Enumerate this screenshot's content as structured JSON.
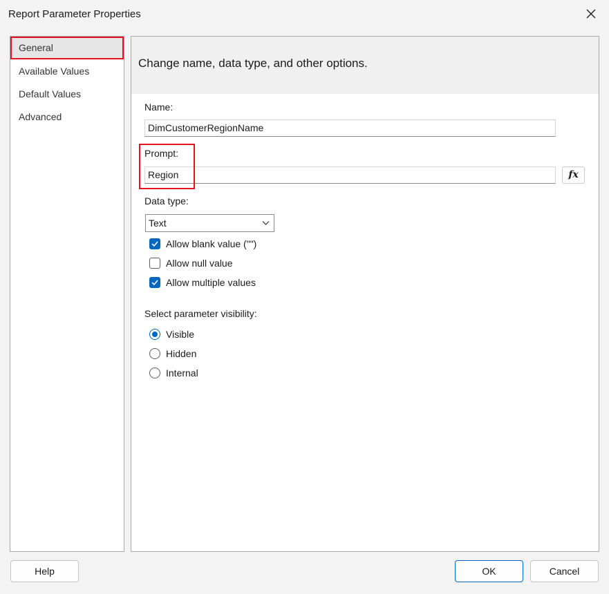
{
  "window": {
    "title": "Report Parameter Properties",
    "close_icon": "close-icon"
  },
  "nav": {
    "items": [
      {
        "label": "General",
        "selected": true
      },
      {
        "label": "Available Values",
        "selected": false
      },
      {
        "label": "Default Values",
        "selected": false
      },
      {
        "label": "Advanced",
        "selected": false
      }
    ]
  },
  "header": {
    "text": "Change name, data type, and other options."
  },
  "form": {
    "name_label": "Name:",
    "name_value": "DimCustomerRegionName",
    "prompt_label": "Prompt:",
    "prompt_value": "Region",
    "fx_label": "fx",
    "data_type_label": "Data type:",
    "data_type_value": "Text",
    "checkboxes": [
      {
        "label": "Allow blank value (\"\")",
        "checked": true
      },
      {
        "label": "Allow null value",
        "checked": false
      },
      {
        "label": "Allow multiple values",
        "checked": true
      }
    ],
    "visibility_label": "Select parameter visibility:",
    "visibility_options": [
      {
        "label": "Visible",
        "selected": true
      },
      {
        "label": "Hidden",
        "selected": false
      },
      {
        "label": "Internal",
        "selected": false
      }
    ]
  },
  "buttons": {
    "help": "Help",
    "ok": "OK",
    "cancel": "Cancel"
  },
  "colors": {
    "accent": "#0067c0",
    "highlight": "#e81123"
  }
}
